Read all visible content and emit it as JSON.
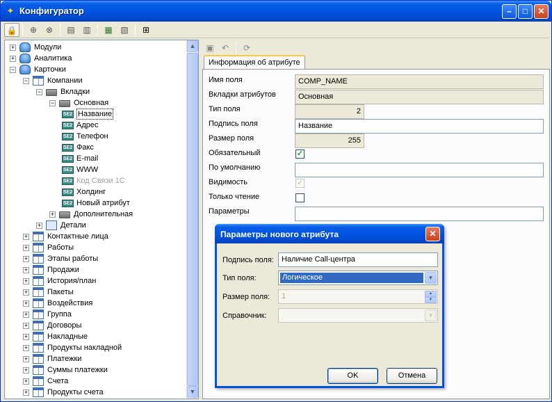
{
  "window": {
    "title": "Конфигуратор"
  },
  "tree": {
    "items": [
      {
        "label": "Модули",
        "level": 0,
        "icon": "database-icon",
        "state": "collapsed"
      },
      {
        "label": "Аналитика",
        "level": 0,
        "icon": "database-icon",
        "state": "collapsed"
      },
      {
        "label": "Карточки",
        "level": 0,
        "icon": "database-icon",
        "state": "expanded"
      },
      {
        "label": "Компании",
        "level": 1,
        "icon": "table-icon",
        "state": "expanded"
      },
      {
        "label": "Вкладки",
        "level": 2,
        "icon": "folder-icon",
        "state": "expanded"
      },
      {
        "label": "Основная",
        "level": 3,
        "icon": "folder-icon",
        "state": "expanded"
      },
      {
        "label": "Название",
        "level": 4,
        "icon": "field-icon",
        "state": "leaf",
        "selected": true
      },
      {
        "label": "Адрес",
        "level": 4,
        "icon": "field-icon",
        "state": "leaf"
      },
      {
        "label": "Телефон",
        "level": 4,
        "icon": "field-icon",
        "state": "leaf"
      },
      {
        "label": "Факс",
        "level": 4,
        "icon": "field-icon",
        "state": "leaf"
      },
      {
        "label": "E-mail",
        "level": 4,
        "icon": "field-icon",
        "state": "leaf"
      },
      {
        "label": "WWW",
        "level": 4,
        "icon": "field-icon",
        "state": "leaf"
      },
      {
        "label": "Код Связи 1С",
        "level": 4,
        "icon": "field-icon",
        "state": "leaf",
        "dim": true
      },
      {
        "label": "Холдинг",
        "level": 4,
        "icon": "field-icon",
        "state": "leaf"
      },
      {
        "label": "Новый атрибут",
        "level": 4,
        "icon": "field-icon",
        "state": "leaf"
      },
      {
        "label": "Дополнительная",
        "level": 3,
        "icon": "folder-icon",
        "state": "collapsed"
      },
      {
        "label": "Детали",
        "level": 2,
        "icon": "hierarchy-icon",
        "state": "collapsed"
      },
      {
        "label": "Контактные лица",
        "level": 1,
        "icon": "table-icon",
        "state": "collapsed"
      },
      {
        "label": "Работы",
        "level": 1,
        "icon": "table-icon",
        "state": "collapsed"
      },
      {
        "label": "Этапы работы",
        "level": 1,
        "icon": "table-icon",
        "state": "collapsed"
      },
      {
        "label": "Продажи",
        "level": 1,
        "icon": "table-icon",
        "state": "collapsed"
      },
      {
        "label": "История/план",
        "level": 1,
        "icon": "table-icon",
        "state": "collapsed"
      },
      {
        "label": "Пакеты",
        "level": 1,
        "icon": "table-icon",
        "state": "collapsed"
      },
      {
        "label": "Воздействия",
        "level": 1,
        "icon": "table-icon",
        "state": "collapsed"
      },
      {
        "label": "Группа",
        "level": 1,
        "icon": "table-icon",
        "state": "collapsed"
      },
      {
        "label": "Договоры",
        "level": 1,
        "icon": "table-icon",
        "state": "collapsed"
      },
      {
        "label": "Накладные",
        "level": 1,
        "icon": "table-icon",
        "state": "collapsed"
      },
      {
        "label": "Продукты накладной",
        "level": 1,
        "icon": "table-icon",
        "state": "collapsed"
      },
      {
        "label": "Платежки",
        "level": 1,
        "icon": "table-icon",
        "state": "collapsed"
      },
      {
        "label": "Суммы платежки",
        "level": 1,
        "icon": "table-icon",
        "state": "collapsed"
      },
      {
        "label": "Счета",
        "level": 1,
        "icon": "table-icon",
        "state": "collapsed"
      },
      {
        "label": "Продукты счета",
        "level": 1,
        "icon": "table-icon",
        "state": "collapsed"
      }
    ]
  },
  "attr_panel": {
    "tab_label": "Информация об атрибуте",
    "fields": {
      "field_name_label": "Имя поля",
      "field_name_value": "COMP_NAME",
      "tabs_label": "Вкладки атрибутов",
      "tabs_value": "Основная",
      "type_label": "Тип поля",
      "type_value": "2",
      "caption_label": "Подпись поля",
      "caption_value": "Название",
      "size_label": "Размер поля",
      "size_value": "255",
      "required_label": "Обязательный",
      "required_checked": true,
      "default_label": "По умолчанию",
      "default_value": "",
      "visible_label": "Видимость",
      "visible_checked": true,
      "readonly_label": "Только чтение",
      "readonly_checked": false,
      "params_label": "Параметры",
      "params_value": ""
    }
  },
  "dialog": {
    "title": "Параметры нового атрибута",
    "caption_label": "Подпись поля:",
    "caption_value": "Наличие Call-центра",
    "type_label": "Тип поля:",
    "type_value": "Логическое",
    "size_label": "Размер поля:",
    "size_value": "1",
    "ref_label": "Справочник:",
    "ref_value": "",
    "ok_label": "OK",
    "cancel_label": "Отмена"
  },
  "colors": {
    "titlebar": "#0054e3",
    "selection": "#316ac5",
    "tab_accent": "#ffc83c"
  }
}
